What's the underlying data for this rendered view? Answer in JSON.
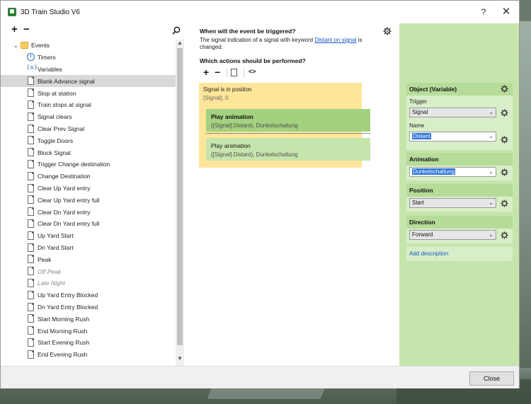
{
  "window": {
    "title": "3D Train Studio V6",
    "help_label": "?",
    "close_label": "✕"
  },
  "left": {
    "add_label": "+",
    "remove_label": "−",
    "tree_root": "Events",
    "special_items": [
      "Timers",
      "Variables"
    ],
    "events": [
      {
        "label": "Blank Advance signal",
        "selected": true
      },
      {
        "label": "Stop at station"
      },
      {
        "label": "Train stops at signal"
      },
      {
        "label": "Signal clears"
      },
      {
        "label": "Clear Prev Signal"
      },
      {
        "label": "Toggle Doors"
      },
      {
        "label": "Block Signal"
      },
      {
        "label": "Trigger Change destination"
      },
      {
        "label": "Change Destination"
      },
      {
        "label": "Clear Up Yard entry"
      },
      {
        "label": "Clear Up Yard entry full"
      },
      {
        "label": "Clear Dn Yard entry"
      },
      {
        "label": "Clear Dn Yard entry full"
      },
      {
        "label": "Up Yard Start"
      },
      {
        "label": "Dn Yard Start"
      },
      {
        "label": "Peak"
      },
      {
        "label": "Off Peak",
        "disabled": true
      },
      {
        "label": "Late Night",
        "disabled": true
      },
      {
        "label": "Up Yard Entry Blocked"
      },
      {
        "label": "Dn Yard Entry Blocked"
      },
      {
        "label": "Start Morning Rush"
      },
      {
        "label": "End Morning Rush"
      },
      {
        "label": "Start Evening Rush"
      },
      {
        "label": "End Evening Rush"
      }
    ]
  },
  "middle": {
    "trigger_question": "When will the event be triggered?",
    "trigger_text_before": "The signal indication of a signal with keyword ",
    "trigger_link": "Distant on signal",
    "trigger_text_after": " is changed.",
    "actions_question": "Which actions should be performed?",
    "toolbar": {
      "add": "+",
      "remove": "−",
      "code": "<>"
    },
    "condition": {
      "title": "Signal is in position",
      "detail": "[Signal], 0"
    },
    "actions": [
      {
        "title": "Play animation",
        "detail": "([Signal].Distant), Dunkelschaltung"
      },
      {
        "title": "Play animation",
        "detail": "([Signal].Distant), Dunkelschaltung"
      }
    ]
  },
  "right": {
    "object": {
      "header": "Object (Variable)",
      "trigger_label": "Trigger",
      "trigger_value": "Signal",
      "name_label": "Name",
      "name_value": "Distant"
    },
    "animation": {
      "header": "Animation",
      "value": "Dunkelschaltung"
    },
    "position": {
      "header": "Position",
      "value": "Start"
    },
    "direction": {
      "header": "Direction",
      "value": "Forward"
    },
    "add_description": "Add description"
  },
  "footer": {
    "close_button": "Close"
  },
  "colors": {
    "accent_green": "#c6e5ad",
    "condition_yellow": "#fde699",
    "link_blue": "#1a56c2",
    "selection_blue": "#2b73d6"
  }
}
